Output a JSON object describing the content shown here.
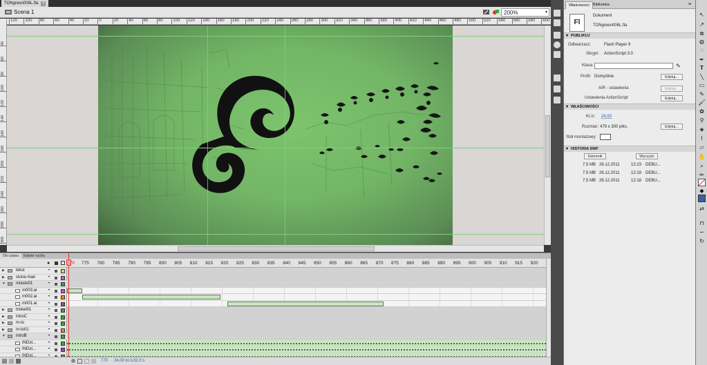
{
  "document": {
    "tab_title": "TONgreen006L.fla",
    "close": "×"
  },
  "editbar": {
    "scene": "Scena 1",
    "zoom": "200%",
    "zoom_arrow": "▾"
  },
  "rulers": {
    "h": [
      "120",
      "100",
      "80",
      "60",
      "40",
      "20",
      "0",
      "20",
      "40",
      "60",
      "80",
      "100",
      "120",
      "140",
      "160",
      "180",
      "200",
      "220",
      "240",
      "260",
      "280",
      "300",
      "320",
      "340",
      "360",
      "380",
      "400",
      "420",
      "440",
      "460",
      "480",
      "500",
      "520",
      "540",
      "560",
      "580",
      "600"
    ],
    "v": [
      "40",
      "60",
      "80",
      "100",
      "120",
      "140",
      "160",
      "180",
      "200",
      "220",
      "240",
      "260",
      "280",
      "300"
    ]
  },
  "timeline": {
    "tabs": [
      "Oś czasu",
      "Edytor ruchu"
    ],
    "frame_numbers": [
      "775",
      "780",
      "785",
      "790",
      "795",
      "800",
      "805",
      "810",
      "815",
      "820",
      "825",
      "830",
      "835",
      "840",
      "845",
      "850",
      "855",
      "860",
      "865",
      "870",
      "875",
      "880",
      "885",
      "890",
      "895",
      "900",
      "905",
      "910",
      "915",
      "920",
      "925",
      "9"
    ],
    "playhead_label": "770",
    "layers": [
      {
        "name": "tekst",
        "type": "folder",
        "color": "#b6e06a",
        "indent": 0
      },
      {
        "name": "stone-man",
        "type": "folder",
        "color": "#c060c0",
        "indent": 0
      },
      {
        "name": "miasto01",
        "type": "folder",
        "color": "#33aa33",
        "indent": 0,
        "open": true
      },
      {
        "name": "m003.ai",
        "type": "layer",
        "color": "#d04ad0",
        "indent": 1
      },
      {
        "name": "m002.ai",
        "type": "layer",
        "color": "#ff8800",
        "indent": 1
      },
      {
        "name": "m001.ai",
        "type": "layer",
        "color": "#9b46b8",
        "indent": 1
      },
      {
        "name": "triskel01",
        "type": "folder",
        "color": "#33aa33",
        "indent": 0
      },
      {
        "name": "introC",
        "type": "folder",
        "color": "#33aa33",
        "indent": 0
      },
      {
        "name": "m-to",
        "type": "folder",
        "color": "#33aa33",
        "indent": 0
      },
      {
        "name": "m-to01",
        "type": "folder",
        "color": "#ff8800",
        "indent": 0
      },
      {
        "name": "introB",
        "type": "folder",
        "color": "#33aa33",
        "indent": 0,
        "open": true
      },
      {
        "name": "INDst...",
        "type": "layer",
        "color": "#33aa33",
        "indent": 1
      },
      {
        "name": "INDst...",
        "type": "layer",
        "color": "#9b46b8",
        "indent": 1
      },
      {
        "name": "INDst...",
        "type": "layer",
        "color": "#33aa33",
        "indent": 1
      }
    ],
    "status": {
      "frame": "770",
      "fps": "24,00 kl./s",
      "time": "32,0 s"
    }
  },
  "properties": {
    "tabs": [
      "Właściwości",
      "Biblioteka"
    ],
    "doc_icon": "Fl",
    "doc_type": "Dokument",
    "doc_name": "TONgreen006L.fla",
    "publish_section": "PUBLIKUJ",
    "player_label": "Odtwarzacz:",
    "player_value": "Flash Player 9",
    "script_label": "Skrypt:",
    "script_value": "ActionScript 3.0",
    "class_label": "Klasa:",
    "class_value": "",
    "profile_label": "Profil:",
    "profile_value": "Domyślnie",
    "edit_btn": "Edytuj...",
    "air_label": "AIR - ustawienia",
    "as_label": "Ustawienia ActionScript",
    "props_section": "WŁAŚCIWOŚCI",
    "fps_label": "Kl./s:",
    "fps_value": "24,00",
    "size_label": "Rozmiar:",
    "size_value": "479 x 300 piks.",
    "stage_label": "Stół montażowy:",
    "stage_color": "#ffffff",
    "swf_section": "HISTORIA SWF",
    "log_btn": "Dziennik",
    "clear_btn": "Wyczyść",
    "swf_history": [
      {
        "size": "7.5 MB",
        "date": "26.12.2011",
        "time": "12:23",
        "note": "DEBU..."
      },
      {
        "size": "7.5 MB",
        "date": "26.12.2011",
        "time": "12:19",
        "note": "DEBU..."
      },
      {
        "size": "7.5 MB",
        "date": "26.12.2011",
        "time": "12:18",
        "note": "DEBU..."
      }
    ]
  },
  "colors": {
    "stage_green": "#72b566",
    "accent_link": "#2a62a8",
    "playhead": "#e33333"
  }
}
